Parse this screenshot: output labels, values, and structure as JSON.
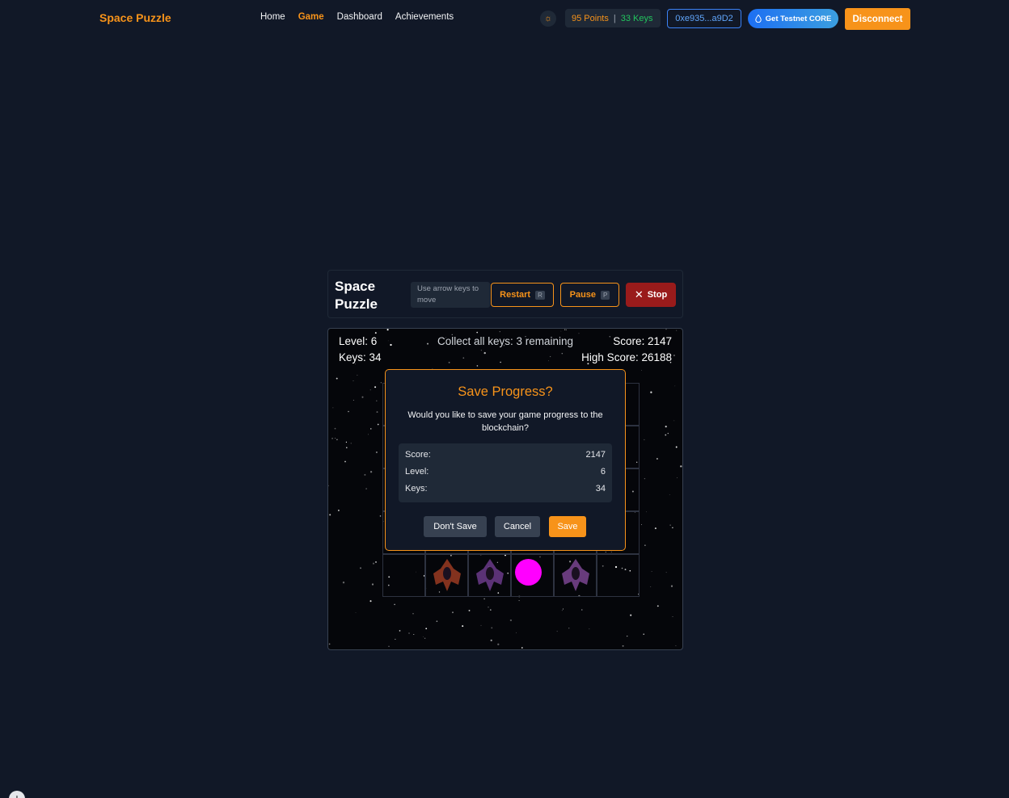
{
  "navbar": {
    "brand": "Space Puzzle",
    "links": [
      "Home",
      "Game",
      "Dashboard",
      "Achievements"
    ],
    "active_link": "Game",
    "points": "95 Points",
    "separator": "|",
    "keys": "33 Keys",
    "wallet": "0xe935...a9D2",
    "faucet": "Get Testnet CORE",
    "disconnect": "Disconnect"
  },
  "game_header": {
    "title": "Space Puzzle",
    "hint": "Use arrow keys to move",
    "restart": "Restart",
    "restart_key": "R",
    "pause": "Pause",
    "pause_key": "P",
    "stop": "Stop"
  },
  "hud": {
    "level": "Level: 6",
    "keys": "Keys: 34",
    "collect": "Collect all keys: 3 remaining",
    "score": "Score: 2147",
    "high_score": "High Score: 26188"
  },
  "modal": {
    "title": "Save Progress?",
    "message": "Would you like to save your game progress to the blockchain?",
    "stats": [
      {
        "label": "Score:",
        "value": "2147"
      },
      {
        "label": "Level:",
        "value": "6"
      },
      {
        "label": "Keys:",
        "value": "34"
      }
    ],
    "dont_save": "Don't Save",
    "cancel": "Cancel",
    "save": "Save"
  },
  "colors": {
    "accent": "#f7931a",
    "background": "#111827",
    "player": "#ff00ff",
    "stop": "#991b1b"
  },
  "icons": {
    "theme": "sun-icon",
    "faucet": "droplet-icon",
    "stop": "close-icon"
  }
}
